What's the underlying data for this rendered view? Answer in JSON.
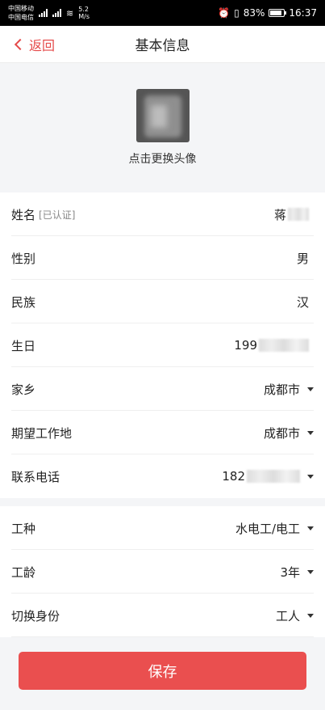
{
  "status_bar": {
    "carrier_1": "中国移动",
    "carrier_2": "中国电信",
    "net_speed": "5.2 M/s",
    "battery": "83%",
    "time": "16:37"
  },
  "nav": {
    "back_label": "返回",
    "title": "基本信息"
  },
  "avatar": {
    "caption": "点击更换头像"
  },
  "profile_rows": [
    {
      "label": "姓名",
      "tag": "[已认证]",
      "value": "蒋"
    },
    {
      "label": "性别",
      "value": "男"
    },
    {
      "label": "民族",
      "value": "汉"
    },
    {
      "label": "生日",
      "value": "199"
    },
    {
      "label": "家乡",
      "value": "成都市"
    },
    {
      "label": "期望工作地",
      "value": "成都市"
    },
    {
      "label": "联系电话",
      "value": "182"
    }
  ],
  "work_rows": [
    {
      "label": "工种",
      "value": "水电工/电工"
    },
    {
      "label": "工龄",
      "value": "3年"
    },
    {
      "label": "切换身份",
      "value": "工人"
    }
  ],
  "footer": {
    "save_label": "保存"
  },
  "colors": {
    "accent": "#ea4f4f",
    "background": "#f4f5f7"
  }
}
